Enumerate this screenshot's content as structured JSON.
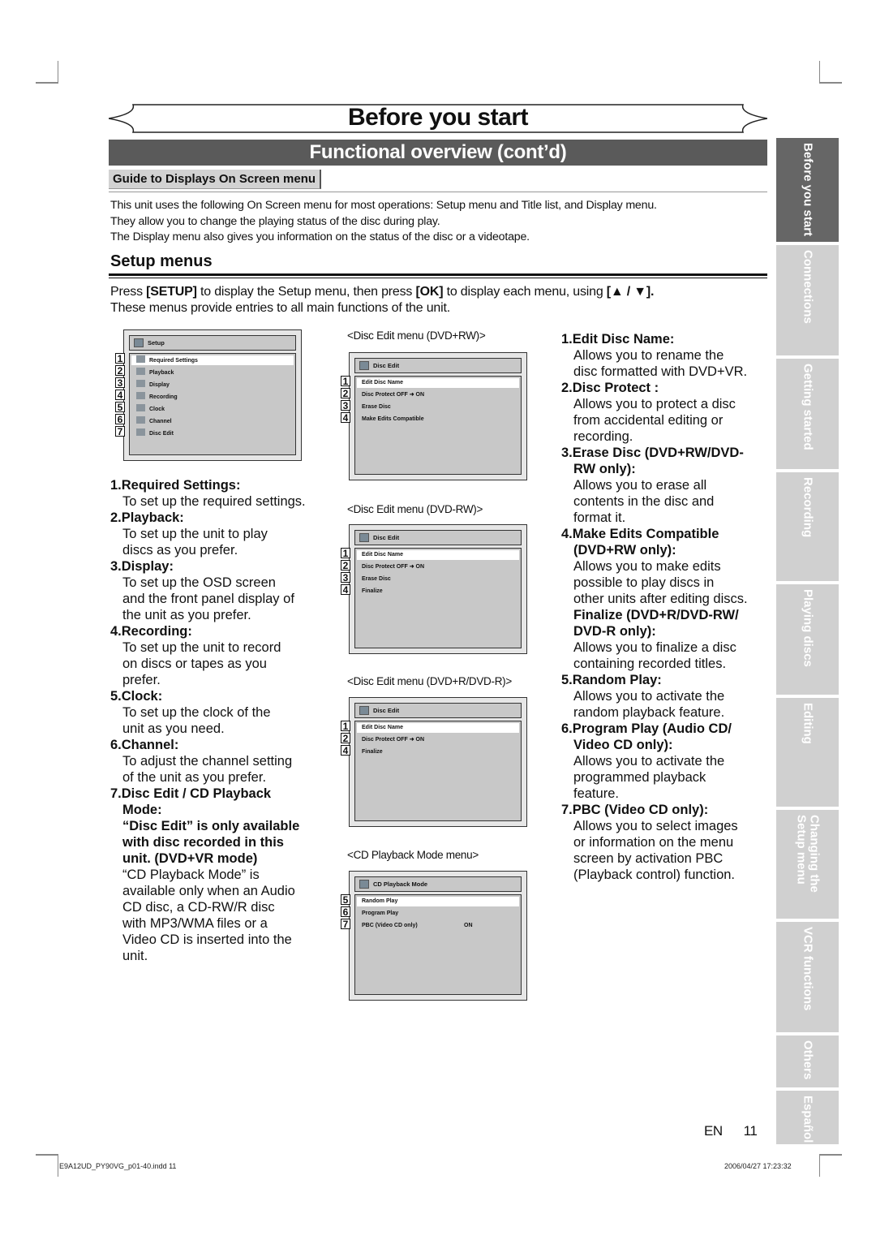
{
  "header": {
    "title": "Before you start",
    "section": "Functional overview (cont’d)",
    "guide_tab": "Guide to Displays On Screen menu"
  },
  "intro": [
    "This unit uses the following On Screen menu for most operations: Setup menu and Title list, and Display menu.",
    "They allow you to change the playing status of the disc during play.",
    "The Display menu also gives you information on the status of the disc or a videotape."
  ],
  "setup": {
    "heading": "Setup menus",
    "press_pre": "Press ",
    "press_setup": "[SETUP]",
    "press_mid": " to display the Setup menu, then press ",
    "press_ok": "[OK]",
    "press_post": " to display each menu, using ",
    "press_keys": "[▲ / ▼].",
    "line2": "These menus provide entries to all main functions of the unit."
  },
  "screens": {
    "setup_menu": {
      "title": "Setup",
      "items": [
        {
          "num": "1",
          "label": "Required Settings"
        },
        {
          "num": "2",
          "label": "Playback"
        },
        {
          "num": "3",
          "label": "Display"
        },
        {
          "num": "4",
          "label": "Recording"
        },
        {
          "num": "5",
          "label": "Clock"
        },
        {
          "num": "6",
          "label": "Channel"
        },
        {
          "num": "7",
          "label": "Disc Edit"
        }
      ]
    },
    "disc_edit_plus_rw": {
      "caption": "<Disc Edit menu (DVD+RW)>",
      "title": "Disc Edit",
      "items": [
        {
          "num": "1",
          "label": "Edit Disc Name"
        },
        {
          "num": "2",
          "label": "Disc Protect OFF ➜ ON"
        },
        {
          "num": "3",
          "label": "Erase Disc"
        },
        {
          "num": "4",
          "label": "Make Edits Compatible"
        }
      ]
    },
    "disc_edit_minus_rw": {
      "caption": "<Disc Edit menu (DVD-RW)>",
      "title": "Disc Edit",
      "items": [
        {
          "num": "1",
          "label": "Edit Disc Name"
        },
        {
          "num": "2",
          "label": "Disc Protect OFF ➜ ON"
        },
        {
          "num": "3",
          "label": "Erase Disc"
        },
        {
          "num": "4",
          "label": "Finalize"
        }
      ]
    },
    "disc_edit_r": {
      "caption": "<Disc Edit menu (DVD+R/DVD-R)>",
      "title": "Disc Edit",
      "items": [
        {
          "num": "1",
          "label": "Edit Disc Name"
        },
        {
          "num": "2",
          "label": "Disc Protect OFF ➜ ON"
        },
        {
          "num": "4",
          "label": "Finalize"
        }
      ]
    },
    "cd_playback": {
      "caption": "<CD Playback Mode menu>",
      "title": "CD Playback Mode",
      "items": [
        {
          "num": "5",
          "label": "Random Play",
          "value": ""
        },
        {
          "num": "6",
          "label": "Program Play",
          "value": ""
        },
        {
          "num": "7",
          "label": "PBC (Video CD only)",
          "value": "ON"
        }
      ]
    }
  },
  "left_desc": [
    {
      "head": "1.Required Settings:",
      "text": [
        "To set up the required settings."
      ]
    },
    {
      "head": "2.Playback:",
      "text": [
        "To set up the unit to play",
        "discs as you prefer."
      ]
    },
    {
      "head": "3.Display:",
      "text": [
        "To set up the OSD screen",
        "and the front panel display of",
        "the unit as you prefer."
      ]
    },
    {
      "head": "4.Recording:",
      "text": [
        "To set up the unit to record",
        "on discs or tapes as you",
        "prefer."
      ]
    },
    {
      "head": "5.Clock:",
      "text": [
        "To set up the clock of the",
        "unit as you need."
      ]
    },
    {
      "head": "6.Channel:",
      "text": [
        "To adjust the channel setting",
        "of the unit as you prefer."
      ]
    },
    {
      "head": "7.Disc Edit / CD Playback",
      "head2": "Mode:",
      "bold_note": [
        "“Disc Edit” is only available",
        "with disc recorded in this",
        "unit. (DVD+VR mode)"
      ],
      "text": [
        "“CD Playback Mode” is",
        "available only when an Audio",
        "CD disc, a CD-RW/R disc",
        "with MP3/WMA files or a",
        "Video CD is inserted into the",
        "unit."
      ]
    }
  ],
  "right_desc": [
    {
      "head": [
        "1.Edit Disc Name:"
      ],
      "text": [
        "Allows you to rename the",
        "disc formatted with DVD+VR."
      ]
    },
    {
      "head": [
        "2.Disc Protect :"
      ],
      "text": [
        "Allows you to protect a disc",
        "from accidental editing or",
        "recording."
      ]
    },
    {
      "head": [
        "3.Erase Disc (DVD+RW/DVD-",
        "RW only):"
      ],
      "text": [
        "Allows you to erase all",
        "contents in the disc and",
        "format it."
      ]
    },
    {
      "head": [
        "4.Make Edits Compatible",
        "(DVD+RW only):"
      ],
      "text": [
        "Allows you to make edits",
        "possible to play discs in",
        "other units after editing discs."
      ]
    },
    {
      "head": [
        "Finalize (DVD+R/DVD-RW/",
        "DVD-R only):"
      ],
      "text": [
        "Allows you to finalize a disc",
        "containing recorded titles."
      ]
    },
    {
      "head": [
        "5.Random Play:"
      ],
      "text": [
        "Allows you to activate the",
        "random playback feature."
      ]
    },
    {
      "head": [
        "6.Program Play (Audio CD/",
        "Video CD only):"
      ],
      "text": [
        "Allows you to activate the",
        "programmed playback",
        "feature."
      ]
    },
    {
      "head": [
        "7.PBC (Video CD only):"
      ],
      "text": [
        "Allows you to select images",
        "or information on the menu",
        "screen by activation PBC",
        "(Playback control) function."
      ]
    }
  ],
  "side_tabs": [
    {
      "label": "Before you start",
      "active": true
    },
    {
      "label": "Connections",
      "active": false
    },
    {
      "label": "Getting started",
      "active": false
    },
    {
      "label": "Recording",
      "active": false
    },
    {
      "label": "Playing discs",
      "active": false
    },
    {
      "label": "Editing",
      "active": false
    },
    {
      "label": "Changing the\nSetup menu",
      "active": false
    },
    {
      "label": "VCR functions",
      "active": false
    },
    {
      "label": "Others",
      "active": false
    },
    {
      "label": "Español",
      "active": false
    }
  ],
  "footer": {
    "lang": "EN",
    "page": "11",
    "slug_file": "E9A12UD_PY90VG_p01-40.indd  11",
    "slug_date": "2006/04/27   17:23:32"
  }
}
